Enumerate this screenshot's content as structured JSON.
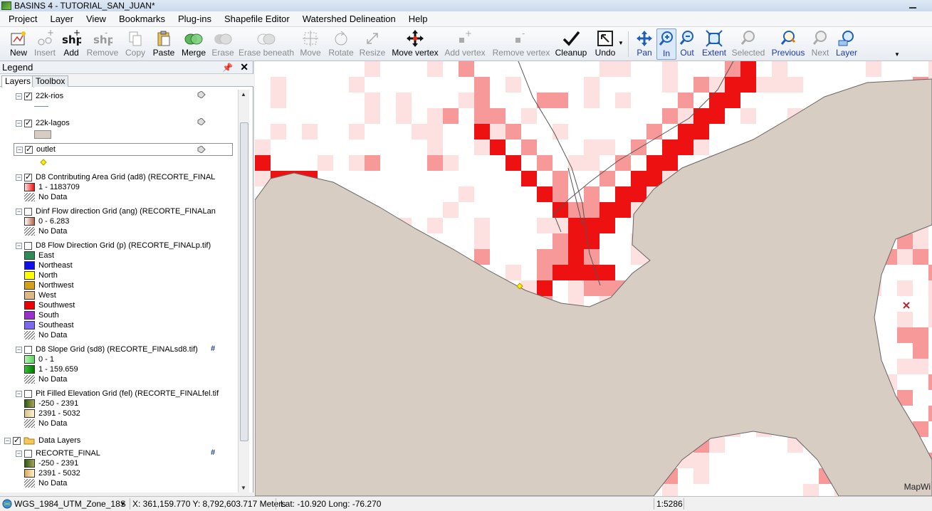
{
  "window": {
    "title": "BASINS 4 - TUTORIAL_SAN_JUAN*"
  },
  "menu": [
    "Project",
    "Layer",
    "View",
    "Bookmarks",
    "Plug-ins",
    "Shapefile Editor",
    "Watershed Delineation",
    "Help"
  ],
  "toolbar": {
    "new": "New",
    "insert": "Insert",
    "add": "Add",
    "remove": "Remove",
    "copy": "Copy",
    "paste": "Paste",
    "merge": "Merge",
    "erase": "Erase",
    "erase_beneath": "Erase beneath",
    "move": "Move",
    "rotate": "Rotate",
    "resize": "Resize",
    "move_vertex": "Move vertex",
    "add_vertex": "Add vertex",
    "remove_vertex": "Remove vertex",
    "cleanup": "Cleanup",
    "undo": "Undo",
    "pan": "Pan",
    "in": "In",
    "out": "Out",
    "extent": "Extent",
    "selected": "Selected",
    "previous": "Previous",
    "next": "Next",
    "layer": "Layer",
    "shp_text": "shp"
  },
  "legend": {
    "title": "Legend",
    "tabs": [
      "Layers",
      "Toolbox"
    ],
    "layers": {
      "rios": "22k-rios",
      "lagos": "22k-lagos",
      "outlet": "outlet",
      "ad8": {
        "name": "D8 Contributing Area Grid (ad8) (RECORTE_FINAL",
        "r1": "1 - 1183709",
        "nodata": "No Data"
      },
      "ang": {
        "name": "Dinf Flow direction Grid  (ang) (RECORTE_FINALan",
        "r1": "0 - 6.283",
        "nodata": "No Data"
      },
      "p": {
        "name": "D8 Flow Direction Grid (p) (RECORTE_FINALp.tif)",
        "classes": [
          "East",
          "Northeast",
          "North",
          "Northwest",
          "West",
          "Southwest",
          "South",
          "Southeast"
        ],
        "nodata": "No Data"
      },
      "sd8": {
        "name": "D8 Slope Grid (sd8) (RECORTE_FINALsd8.tif)",
        "r1": "0 - 1",
        "r2": "1 - 159.659",
        "nodata": "No Data"
      },
      "fel": {
        "name": "Pit Filled Elevation Grid (fel) (RECORTE_FINALfel.tif",
        "r1": "-250 - 2391",
        "r2": "2391 - 5032",
        "nodata": "No Data"
      },
      "group": "Data Layers",
      "recorte": {
        "name": "RECORTE_FINAL",
        "r1": "-250 - 2391",
        "r2": "2391 - 5032",
        "nodata": "No Data"
      }
    }
  },
  "colors": {
    "lake": "#d7cdc3",
    "flow_high": "#ee1111",
    "flow_mid": "#f79999",
    "flow_low": "#fde0e0",
    "p_classes": [
      "#2e8b57",
      "#1010ee",
      "#ffff00",
      "#d4a017",
      "#deb887",
      "#ee0000",
      "#9932cc",
      "#7b68ee"
    ]
  },
  "map": {
    "watermark": "MapWi"
  },
  "status": {
    "projection": "WGS_1984_UTM_Zone_18S",
    "xy": "X: 361,159.770 Y: 8,792,603.717 Meters",
    "latlong": "Lat: -10.920 Long: -76.270",
    "scale": "1:5286"
  }
}
